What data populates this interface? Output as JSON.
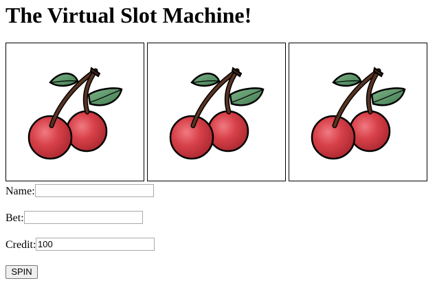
{
  "title": "The Virtual Slot Machine!",
  "reels": [
    {
      "symbol": "cherry-icon"
    },
    {
      "symbol": "cherry-icon"
    },
    {
      "symbol": "cherry-icon"
    }
  ],
  "form": {
    "name_label": "Name:",
    "name_value": "",
    "bet_label": "Bet:",
    "bet_value": "",
    "credit_label": "Credit:",
    "credit_value": "100",
    "spin_label": "SPIN"
  },
  "colors": {
    "cherry_red": "#cf3b42",
    "leaf_green": "#5f9a6c",
    "stem_brown": "#3d2217"
  }
}
